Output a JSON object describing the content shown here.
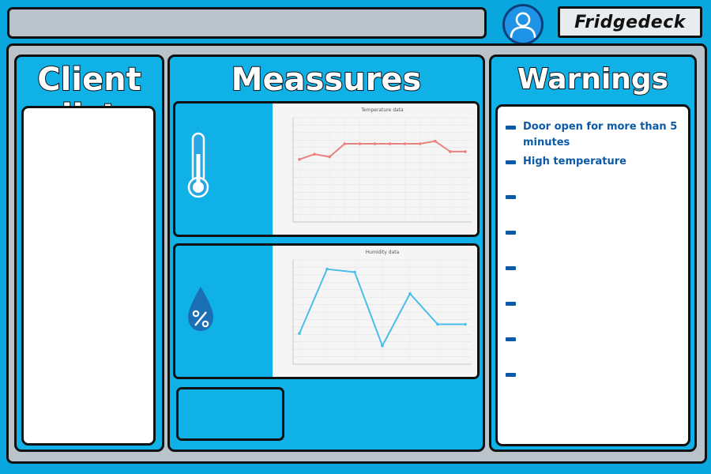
{
  "header": {
    "brand": "Fridgedeck",
    "avatar_icon": "user-icon"
  },
  "panels": {
    "client_list": {
      "title": "Client list"
    },
    "measures": {
      "title": "Meassures"
    },
    "warnings": {
      "title": "Warnings",
      "items": [
        "Door open for more than 5 minutes",
        "High temperature",
        "",
        "",
        "",
        "",
        "",
        ""
      ]
    }
  },
  "charts": [
    {
      "icon": "thermometer-icon",
      "chart_data": {
        "type": "line",
        "title": "Temperature data",
        "line_color": "#e8837f",
        "values": [
          24,
          26,
          25,
          30,
          30,
          30,
          30,
          30,
          30,
          31,
          27,
          27
        ],
        "ylim": [
          0,
          40
        ]
      }
    },
    {
      "icon": "humidity-drop-icon",
      "chart_data": {
        "type": "line",
        "title": "Humidity data",
        "line_color": "#4bbde8",
        "values": [
          10,
          31,
          30,
          6,
          23,
          13,
          13
        ],
        "ylim": [
          0,
          34
        ]
      }
    }
  ],
  "colors": {
    "accent": "#0fb1e6",
    "warning_text": "#0a5aa8",
    "panel_bg": "#b9c3c9"
  }
}
